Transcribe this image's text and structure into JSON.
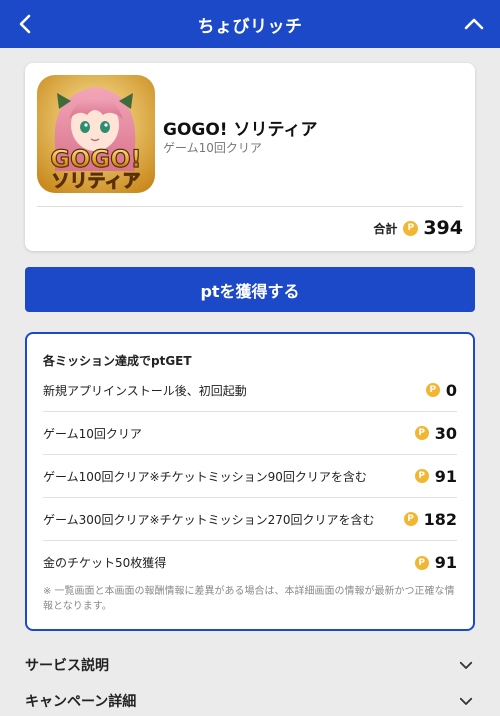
{
  "header": {
    "title": "ちょびリッチ"
  },
  "app": {
    "name": "GOGO! ソリティア",
    "subtitle": "ゲーム10回クリア",
    "icon_text_line1": "GOGO!",
    "icon_text_line2": "ソリティア",
    "total_label": "合計",
    "total_value": "394"
  },
  "cta_label": "ptを獲得する",
  "missions": {
    "header": "各ミッション達成でptGET",
    "items": [
      {
        "label": "新規アプリインストール後、初回起動",
        "points": "0"
      },
      {
        "label": "ゲーム10回クリア",
        "points": "30"
      },
      {
        "label": "ゲーム100回クリア※チケットミッション90回クリアを含む",
        "points": "91"
      },
      {
        "label": "ゲーム300回クリア※チケットミッション270回クリアを含む",
        "points": "182"
      },
      {
        "label": "金のチケット50枚獲得",
        "points": "91"
      }
    ],
    "note": "※ 一覧画面と本画面の報酬情報に差異がある場合は、本詳細画面の情報が最新かつ正確な情報となります。"
  },
  "accordion": [
    {
      "label": "サービス説明"
    },
    {
      "label": "キャンペーン詳細"
    }
  ],
  "coin_symbol": "P",
  "colors": {
    "primary": "#1c49c8",
    "coin": "#f2b632",
    "background": "#ebebeb"
  },
  "icons": [
    "chevron-left-icon",
    "chevron-up-icon",
    "chevron-down-icon",
    "point-coin-icon"
  ]
}
